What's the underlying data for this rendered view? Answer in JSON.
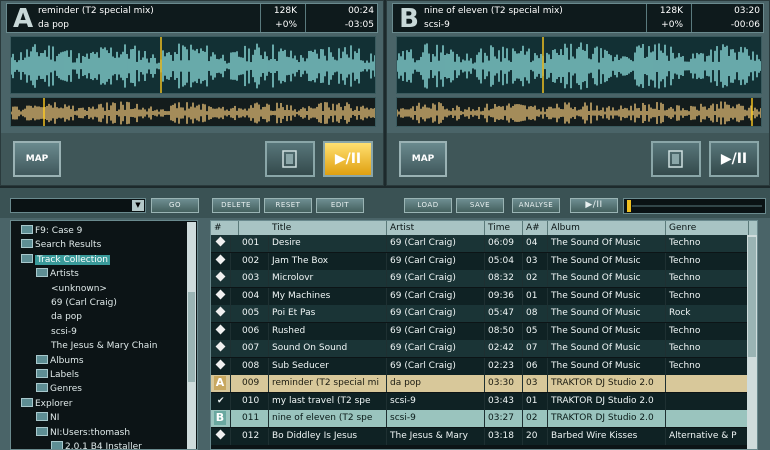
{
  "deck_a": {
    "letter": "A",
    "title": "reminder (T2 special mix)",
    "artist": "da pop",
    "bitrate": "128K",
    "pitch": "+0%",
    "elapsed": "00:24",
    "remaining": "-03:05",
    "map_label": "MAP",
    "play_label": "▶/II",
    "playhead": 0.09
  },
  "deck_b": {
    "letter": "B",
    "title": "nine of eleven (T2 special mix)",
    "artist": "scsi-9",
    "bitrate": "128K",
    "pitch": "+0%",
    "elapsed": "03:20",
    "remaining": "-00:06",
    "map_label": "MAP",
    "play_label": "▶/II",
    "playhead": 0.97
  },
  "toolbar": {
    "go": "GO",
    "delete": "DELETE",
    "reset": "RESET",
    "edit": "EDIT",
    "load": "LOAD",
    "save": "SAVE",
    "analyse": "ANALYSE",
    "preview_play": "▶/II"
  },
  "tree": [
    {
      "label": "F9: Case 9",
      "indent": 0,
      "icon": "folder-icon"
    },
    {
      "label": "Search Results",
      "indent": 0,
      "icon": "search-icon"
    },
    {
      "label": "Track Collection",
      "indent": 0,
      "icon": "collection-icon",
      "selected": true
    },
    {
      "label": "Artists",
      "indent": 1,
      "icon": "folder-icon"
    },
    {
      "label": "<unknown>",
      "indent": 2
    },
    {
      "label": "69 (Carl Craig)",
      "indent": 2
    },
    {
      "label": "da pop",
      "indent": 2
    },
    {
      "label": "scsi-9",
      "indent": 2
    },
    {
      "label": "The Jesus & Mary Chain",
      "indent": 2
    },
    {
      "label": "Albums",
      "indent": 1,
      "icon": "folder-icon"
    },
    {
      "label": "Labels",
      "indent": 1,
      "icon": "folder-icon"
    },
    {
      "label": "Genres",
      "indent": 1,
      "icon": "folder-icon"
    },
    {
      "label": "Explorer",
      "indent": 0,
      "icon": "folder-icon"
    },
    {
      "label": "NI",
      "indent": 1,
      "icon": "folder-icon"
    },
    {
      "label": "NI:Users:thomash",
      "indent": 1,
      "icon": "folder-icon"
    },
    {
      "label": "2.0.1 B4 Installer",
      "indent": 2,
      "icon": "folder-icon"
    }
  ],
  "table": {
    "headers": [
      "#",
      "Title",
      "Artist",
      "Time",
      "A#",
      "Album",
      "Genre"
    ],
    "rows": [
      {
        "mark": "diamond",
        "num": "001",
        "title": "Desire",
        "artist": "69 (Carl Craig)",
        "time": "06:09",
        "track": "04",
        "album": "The Sound Of Music",
        "genre": "Techno"
      },
      {
        "mark": "diamond",
        "num": "002",
        "title": "Jam The Box",
        "artist": "69 (Carl Craig)",
        "time": "05:04",
        "track": "03",
        "album": "The Sound Of Music",
        "genre": "Techno"
      },
      {
        "mark": "diamond",
        "num": "003",
        "title": "Microlovr",
        "artist": "69 (Carl Craig)",
        "time": "08:32",
        "track": "02",
        "album": "The Sound Of Music",
        "genre": "Techno"
      },
      {
        "mark": "diamond",
        "num": "004",
        "title": "My Machines",
        "artist": "69 (Carl Craig)",
        "time": "09:36",
        "track": "01",
        "album": "The Sound Of Music",
        "genre": "Techno"
      },
      {
        "mark": "diamond",
        "num": "005",
        "title": "Poi Et Pas",
        "artist": "69 (Carl Craig)",
        "time": "05:47",
        "track": "08",
        "album": "The Sound Of Music",
        "genre": "Rock"
      },
      {
        "mark": "diamond",
        "num": "006",
        "title": "Rushed",
        "artist": "69 (Carl Craig)",
        "time": "08:50",
        "track": "05",
        "album": "The Sound Of Music",
        "genre": "Techno"
      },
      {
        "mark": "diamond",
        "num": "007",
        "title": "Sound On Sound",
        "artist": "69 (Carl Craig)",
        "time": "02:42",
        "track": "07",
        "album": "The Sound Of Music",
        "genre": "Techno"
      },
      {
        "mark": "diamond",
        "num": "008",
        "title": "Sub Seducer",
        "artist": "69 (Carl Craig)",
        "time": "02:23",
        "track": "06",
        "album": "The Sound Of Music",
        "genre": "Techno"
      },
      {
        "mark": "A",
        "num": "009",
        "title": "reminder (T2 special mi",
        "artist": "da pop",
        "time": "03:30",
        "track": "03",
        "album": "TRAKTOR DJ Studio 2.0",
        "genre": "",
        "state": "loadedA"
      },
      {
        "mark": "check",
        "num": "010",
        "title": "my last travel (T2 spe",
        "artist": "scsi-9",
        "time": "03:43",
        "track": "01",
        "album": "TRAKTOR DJ Studio 2.0",
        "genre": ""
      },
      {
        "mark": "B",
        "num": "011",
        "title": "nine of eleven (T2 spe",
        "artist": "scsi-9",
        "time": "03:27",
        "track": "02",
        "album": "TRAKTOR DJ Studio 2.0",
        "genre": "",
        "state": "loadedB"
      },
      {
        "mark": "diamond",
        "num": "012",
        "title": "Bo Diddley Is Jesus",
        "artist": "The Jesus & Mary",
        "time": "03:18",
        "track": "20",
        "album": "Barbed Wire Kisses",
        "genre": "Alternative & P"
      }
    ]
  },
  "colors": {
    "deck_bg": "#4a6468",
    "wave_cyan": "#7ec8c8",
    "wave_overview": "#c8a86a",
    "play_active": "#f0c020",
    "marker": "#f0c020"
  }
}
